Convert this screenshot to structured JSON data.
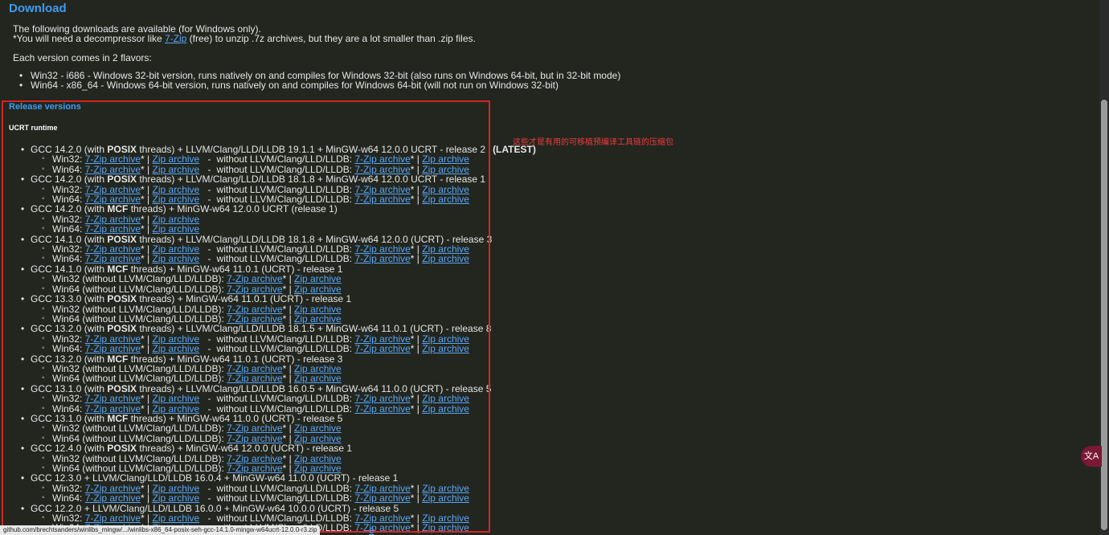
{
  "download": {
    "title": "Download",
    "intro1": "The following downloads are available (for Windows only).",
    "intro2_pre": "*You will need a decompressor like ",
    "intro2_link": "7-Zip",
    "intro2_post": " (free) to unzip .7z archives, but they are a lot smaller than .zip files.",
    "flavors_intro": "Each version comes in 2 flavors:",
    "flavors": [
      "Win32 - i686 - Windows 32-bit version, runs natively on and compiles for Windows 32-bit (also runs on Windows 64-bit, but in 32-bit mode)",
      "Win64 - x86_64 - Windows 64-bit version, runs natively on and compiles for Windows 64-bit (will not run on Windows 32-bit)"
    ]
  },
  "release": {
    "title": "Release versions",
    "runtime": "UCRT runtime",
    "latest_label": "(LATEST)",
    "seven_zip": "7-Zip archive",
    "zip": "Zip archive",
    "without_llvm_dash": "without LLVM/Clang/LLD/LLDB:",
    "items": [
      {
        "pre": "GCC 14.2.0 (with ",
        "bold": "POSIX",
        "post": " threads) + LLVM/Clang/LLD/LLDB 19.1.1 + MinGW-w64 12.0.0 UCRT - release 2",
        "latest": true,
        "style": "dash"
      },
      {
        "pre": "GCC 14.2.0 (with ",
        "bold": "POSIX",
        "post": " threads) + LLVM/Clang/LLD/LLDB 18.1.8 + MinGW-w64 12.0.0 UCRT - release 1",
        "latest": false,
        "style": "dash"
      },
      {
        "pre": "GCC 14.2.0 (with ",
        "bold": "MCF",
        "post": " threads) + MinGW-w64 12.0.0 UCRT (release 1)",
        "latest": false,
        "style": "simple"
      },
      {
        "pre": "GCC 14.1.0 (with ",
        "bold": "POSIX",
        "post": " threads) + LLVM/Clang/LLD/LLDB 18.1.8 + MinGW-w64 12.0.0 (UCRT) - release 3",
        "latest": false,
        "style": "dash"
      },
      {
        "pre": "GCC 14.1.0 (with ",
        "bold": "MCF",
        "post": " threads) + MinGW-w64 11.0.1 (UCRT) - release 1",
        "latest": false,
        "style": "paren"
      },
      {
        "pre": "GCC 13.3.0 (with ",
        "bold": "POSIX",
        "post": " threads) + MinGW-w64 11.0.1 (UCRT) - release 1",
        "latest": false,
        "style": "paren"
      },
      {
        "pre": "GCC 13.2.0 (with ",
        "bold": "POSIX",
        "post": " threads) + LLVM/Clang/LLD/LLDB 18.1.5 + MinGW-w64 11.0.1 (UCRT) - release 8",
        "latest": false,
        "style": "dash"
      },
      {
        "pre": "GCC 13.2.0 (with ",
        "bold": "MCF",
        "post": " threads) + MinGW-w64 11.0.1 (UCRT) - release 3",
        "latest": false,
        "style": "paren"
      },
      {
        "pre": "GCC 13.1.0 (with ",
        "bold": "POSIX",
        "post": " threads) + LLVM/Clang/LLD/LLDB 16.0.5 + MinGW-w64 11.0.0 (UCRT) - release 5",
        "latest": false,
        "style": "dash"
      },
      {
        "pre": "GCC 13.1.0 (with ",
        "bold": "MCF",
        "post": " threads) + MinGW-w64 11.0.0 (UCRT) - release 5",
        "latest": false,
        "style": "paren"
      },
      {
        "pre": "GCC 12.4.0 (with ",
        "bold": "POSIX",
        "post": " threads) + MinGW-w64 12.0.0 (UCRT) - release 1",
        "latest": false,
        "style": "paren"
      },
      {
        "pre": "GCC 12.3.0 + LLVM/Clang/LLD/LLDB 16.0.4 + MinGW-w64 11.0.0 (UCRT) - release 1",
        "bold": "",
        "post": "",
        "latest": false,
        "style": "dash"
      },
      {
        "pre": "GCC 12.2.0 + LLVM/Clang/LLD/LLDB 16.0.0 + MinGW-w64 10.0.0 (UCRT) - release 5",
        "bold": "",
        "post": "",
        "latest": false,
        "style": "dash",
        "truncated": true
      }
    ]
  },
  "annotation": "这些才是有用的可移植预编译工具链的压缩包",
  "status_url": "github.com/brechtsanders/winlibs_mingw/.../winlibs-x86_64-posix-seh-gcc-14.1.0-mingw-w64ucrt-12.0.0-r3.zip",
  "status_partial": "e",
  "translate_icon": "translate-icon",
  "colors": {
    "background": "#22261f",
    "link": "#5aa6f5",
    "heading": "#3e9cf1",
    "annotation": "#f03b3b",
    "highlight_box": "#d62323"
  }
}
